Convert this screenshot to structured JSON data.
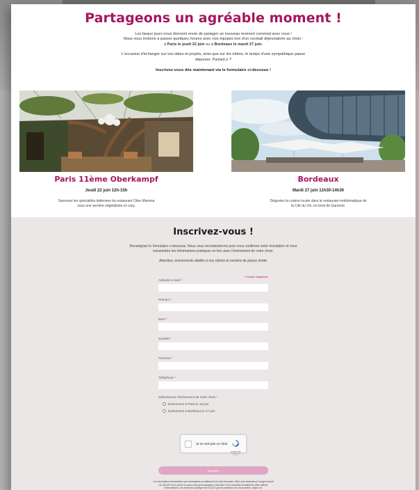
{
  "header": {
    "title": "Partageons un agréable moment !",
    "intro_line1": "Les beaux jours nous donnent envie de partager un nouveau moment convivial avec vous !",
    "intro_line2": "Nous vous invitons à passer quelques heures avec nos équipes lors d'un cocktail déjeunatoire au choix :",
    "intro_line3_pre": "à ",
    "intro_line3_paris": "Paris le jeudi 22 juin",
    "intro_line3_mid": " ou à ",
    "intro_line3_bordeaux": "Bordeaux le mardi 27 juin",
    "intro_line3_post": ".",
    "intro_line4": "L'occasion d'échanger sur vos idées et projets, ainsi que sur les nôtres, le temps d'une sympathique pause",
    "intro_line5": "déjeuner. Partant.e ?",
    "cta": "Inscrivez-vous dès maintenant via le formulaire ci-dessous !"
  },
  "venues": {
    "paris": {
      "name": "Paris 11ème Oberkampf",
      "date": "Jeudi 22 juin 12h-15h",
      "desc_line1": "Savourez les spécialités italiennes du restaurant Ober Mamma",
      "desc_line2": "sous une verrière végétalisée et cosy."
    },
    "bordeaux": {
      "name": "Bordeaux",
      "date": "Mardi 27 juin 11h30-14h30",
      "desc_line1": "Dégustez la cuisine locale dans le restaurant emblématique de",
      "desc_line2": "la Cité du Vin, en bord de Garonne."
    }
  },
  "form": {
    "title": "Inscrivez-vous !",
    "intro_line1": "Renseignez le formulaire ci-dessous. Nous vous recontacterons pour vous confirmer votre inscription et vous",
    "intro_line2": "transmettre les informations pratiques en lien avec l'évènement de votre choix.",
    "note": "Attention, évènements dédiés à nos clients et nombre de places limité.",
    "required_note": "* Champs obligatoires",
    "fields": [
      {
        "label": "Adresse e-mail",
        "value": ""
      },
      {
        "label": "Prénom",
        "value": ""
      },
      {
        "label": "Nom",
        "value": ""
      },
      {
        "label": "Société",
        "value": ""
      },
      {
        "label": "Fonction",
        "value": ""
      },
      {
        "label": "Téléphone",
        "value": ""
      }
    ],
    "required_mark": " *",
    "event_label": "Sélectionnez l'évènement de votre choix",
    "event_options": [
      "Evènement à Paris le 22 juin",
      "Evènement à Bordeaux le 27 juin"
    ],
    "captcha": {
      "label": "Je ne suis pas un robot",
      "brand": "reCAPTCHA",
      "terms": "Confidentialité - Conditions"
    },
    "submit_label": "Envoyer",
    "legal_line1": "Les informations demandées sont nécessaires au traitement de votre demande. Elles sont réservées à l'usage exclusif",
    "legal_line2": "de GOLIAT et ne seront en aucun cas communiquées à des tiers. Pour connaître la finalité de cette collecte",
    "legal_line3": "d'informations, vos droits et la politique de GOLIAT pour la protection de vos données,",
    "legal_link": "cliquez ici."
  },
  "colors": {
    "brand": "#a3165f",
    "form_bg": "#ece7e7",
    "submit_bg": "#e0a7c3"
  }
}
